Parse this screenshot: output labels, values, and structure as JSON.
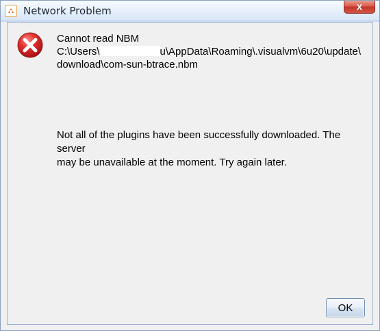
{
  "window": {
    "title": "Network Problem",
    "close_symbol": "X"
  },
  "icons": {
    "app_icon": "application-icon",
    "error_icon": "error-icon"
  },
  "message": {
    "heading": "Cannot read NBM",
    "path_prefix": "C:\\Users\\",
    "path_after_redaction": "u\\AppData\\Roaming\\.visualvm\\6u20\\update\\",
    "path_line_2": "download\\com-sun-btrace.nbm",
    "detail_line_1": "Not all of the plugins have been successfully downloaded. The server",
    "detail_line_2": "may be unavailable at the moment. Try again later."
  },
  "buttons": {
    "ok": "OK"
  },
  "colors": {
    "window_background": "#f0f0f0",
    "error_red": "#d61f26",
    "close_button_red": "#c2352b"
  }
}
